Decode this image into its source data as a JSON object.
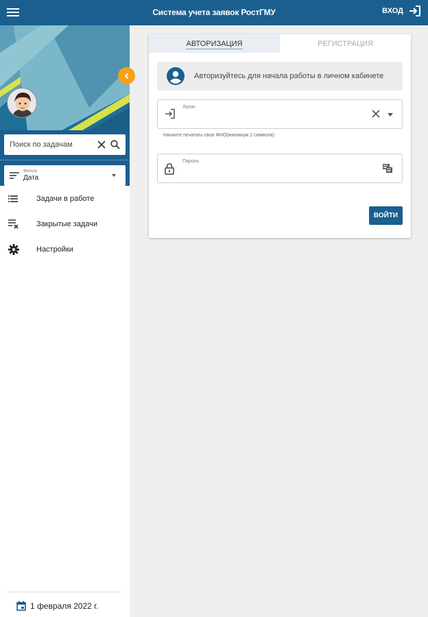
{
  "header": {
    "title": "Система учета заявок РостГМУ",
    "login_label": "ВХОД"
  },
  "sidebar": {
    "search": {
      "placeholder": "Поиск по задачам",
      "value": ""
    },
    "filter": {
      "caption": "Фильтр",
      "value": "Дата"
    },
    "nav_items": [
      {
        "label": "Задачи в работе",
        "icon": "list-icon"
      },
      {
        "label": "Закрытые задачи",
        "icon": "clear-list-icon"
      },
      {
        "label": "Настройки",
        "icon": "gear-icon"
      }
    ],
    "footer_date": "1 февраля 2022 г."
  },
  "auth_card": {
    "tabs": [
      {
        "label": "АВТОРИЗАЦИЯ",
        "active": true
      },
      {
        "label": "РЕГИСТРАЦИЯ",
        "active": false
      }
    ],
    "notice": "Авторизуйтесь для начала работы в личном кабинете",
    "login_field": {
      "label": "Логин",
      "value": "",
      "hint": "Начните печатать свое ФИО(минимум 2 символа)"
    },
    "password_field": {
      "label": "Пароль",
      "value": ""
    },
    "submit_label": "ВОЙТИ"
  },
  "colors": {
    "primary": "#1a5f8f",
    "accent": "#f5a219",
    "background": "#efefef"
  }
}
